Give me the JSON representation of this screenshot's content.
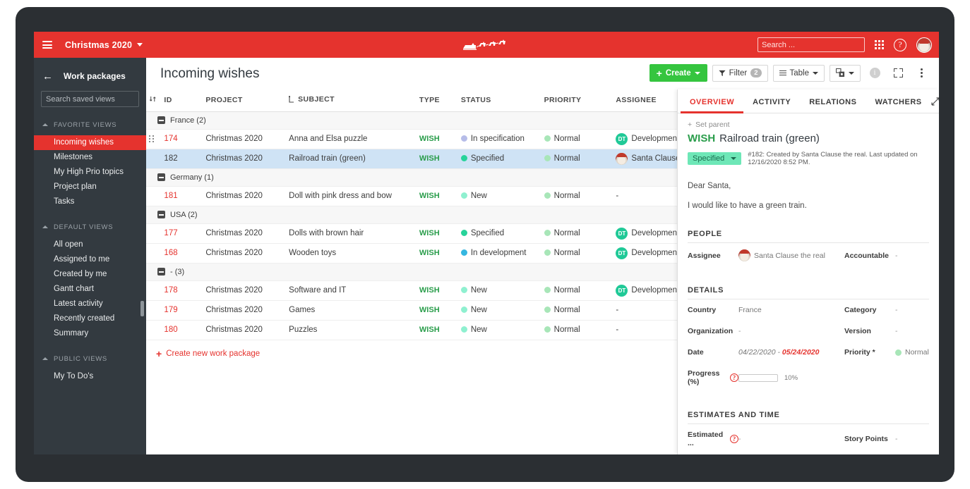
{
  "theme": {
    "brand_red": "#e5332e",
    "sidebar_dark": "#333a40",
    "create_green": "#35c53f",
    "type_green": "#2a9d4b",
    "selected_row_blue": "#cfe3f5"
  },
  "topbar": {
    "menu_icon": "hamburger-icon",
    "project_name": "Christmas 2020",
    "project_caret": "chevron-down-icon",
    "logo": "santa-sleigh-reindeer-logo",
    "search_placeholder": "Search ...",
    "search_value": "",
    "search_icon": "search-icon",
    "apps_icon": "grid-apps-icon",
    "help_icon": "help-circle-icon",
    "help_glyph": "?",
    "avatar": "user-avatar-santa"
  },
  "sidebar": {
    "back_icon": "arrow-left-icon",
    "title": "Work packages",
    "search_placeholder": "Search saved views",
    "search_value": "",
    "search_icon": "search-icon",
    "groups": [
      {
        "label": "FAVORITE VIEWS",
        "items": [
          {
            "label": "Incoming wishes",
            "active": true
          },
          {
            "label": "Milestones",
            "active": false
          },
          {
            "label": "My High Prio topics",
            "active": false
          },
          {
            "label": "Project plan",
            "active": false
          },
          {
            "label": "Tasks",
            "active": false
          }
        ]
      },
      {
        "label": "DEFAULT VIEWS",
        "items": [
          {
            "label": "All open",
            "active": false
          },
          {
            "label": "Assigned to me",
            "active": false
          },
          {
            "label": "Created by me",
            "active": false
          },
          {
            "label": "Gantt chart",
            "active": false
          },
          {
            "label": "Latest activity",
            "active": false
          },
          {
            "label": "Recently created",
            "active": false
          },
          {
            "label": "Summary",
            "active": false
          }
        ]
      },
      {
        "label": "PUBLIC VIEWS",
        "items": [
          {
            "label": "My To Do's",
            "active": false
          }
        ]
      }
    ]
  },
  "main": {
    "page_title": "Incoming wishes",
    "toolbar": {
      "create_label": "Create",
      "filter_label": "Filter",
      "filter_count": "2",
      "table_label": "Table",
      "settings_icon": "view-configuration-icon",
      "info_icon": "info-circle-icon",
      "fullscreen_icon": "fullscreen-icon",
      "more_icon": "kebab-more-icon"
    },
    "columns": [
      {
        "key": "sort",
        "label": "",
        "icon": "sort-icon"
      },
      {
        "key": "id",
        "label": "ID"
      },
      {
        "key": "project",
        "label": "PROJECT"
      },
      {
        "key": "subject",
        "label": "SUBJECT",
        "icon": "hierarchy-icon"
      },
      {
        "key": "type",
        "label": "TYPE"
      },
      {
        "key": "status",
        "label": "STATUS"
      },
      {
        "key": "priority",
        "label": "PRIORITY"
      },
      {
        "key": "assignee",
        "label": "ASSIGNEE"
      }
    ],
    "groups": [
      {
        "label": "France (2)",
        "rows": [
          {
            "id": "174",
            "project": "Christmas 2020",
            "subject": "Anna and Elsa puzzle",
            "type": "WISH",
            "status": "In specification",
            "status_color": "#b6bce8",
            "priority": "Normal",
            "priority_color": "#a8e6b8",
            "assignee": "Development",
            "assignee_initials": "DT",
            "assignee_kind": "team",
            "selected": false,
            "has_handle": true
          },
          {
            "id": "182",
            "project": "Christmas 2020",
            "subject": "Railroad train (green)",
            "type": "WISH",
            "status": "Specified",
            "status_color": "#27d39a",
            "priority": "Normal",
            "priority_color": "#a8e6b8",
            "assignee": "Santa Clause t",
            "assignee_initials": "",
            "assignee_kind": "santa",
            "selected": true,
            "has_handle": false
          }
        ]
      },
      {
        "label": "Germany (1)",
        "rows": [
          {
            "id": "181",
            "project": "Christmas 2020",
            "subject": "Doll with pink dress and bow",
            "type": "WISH",
            "status": "New",
            "status_color": "#8ff0d0",
            "priority": "Normal",
            "priority_color": "#a8e6b8",
            "assignee": "-",
            "assignee_initials": "",
            "assignee_kind": "none",
            "selected": false,
            "has_handle": false
          }
        ]
      },
      {
        "label": "USA (2)",
        "rows": [
          {
            "id": "177",
            "project": "Christmas 2020",
            "subject": "Dolls with brown hair",
            "type": "WISH",
            "status": "Specified",
            "status_color": "#27d39a",
            "priority": "Normal",
            "priority_color": "#a8e6b8",
            "assignee": "Development",
            "assignee_initials": "DT",
            "assignee_kind": "team",
            "selected": false,
            "has_handle": false
          },
          {
            "id": "168",
            "project": "Christmas 2020",
            "subject": "Wooden toys",
            "type": "WISH",
            "status": "In development",
            "status_color": "#35b7e0",
            "priority": "Normal",
            "priority_color": "#a8e6b8",
            "assignee": "Development",
            "assignee_initials": "DT",
            "assignee_kind": "team",
            "selected": false,
            "has_handle": false
          }
        ]
      },
      {
        "label": "- (3)",
        "rows": [
          {
            "id": "178",
            "project": "Christmas 2020",
            "subject": "Software and IT",
            "type": "WISH",
            "status": "New",
            "status_color": "#8ff0d0",
            "priority": "Normal",
            "priority_color": "#a8e6b8",
            "assignee": "Development",
            "assignee_initials": "DT",
            "assignee_kind": "team",
            "selected": false,
            "has_handle": false
          },
          {
            "id": "179",
            "project": "Christmas 2020",
            "subject": "Games",
            "type": "WISH",
            "status": "New",
            "status_color": "#8ff0d0",
            "priority": "Normal",
            "priority_color": "#a8e6b8",
            "assignee": "-",
            "assignee_initials": "",
            "assignee_kind": "none",
            "selected": false,
            "has_handle": false
          },
          {
            "id": "180",
            "project": "Christmas 2020",
            "subject": "Puzzles",
            "type": "WISH",
            "status": "New",
            "status_color": "#8ff0d0",
            "priority": "Normal",
            "priority_color": "#a8e6b8",
            "assignee": "-",
            "assignee_initials": "",
            "assignee_kind": "none",
            "selected": false,
            "has_handle": false
          }
        ]
      }
    ],
    "create_new_label": "Create new work package"
  },
  "detail_panel": {
    "tabs": [
      {
        "label": "OVERVIEW",
        "active": true
      },
      {
        "label": "ACTIVITY",
        "active": false
      },
      {
        "label": "RELATIONS",
        "active": false
      },
      {
        "label": "WATCHERS",
        "active": false
      }
    ],
    "expand_icon": "expand-diagonal-icon",
    "close_icon": "close-icon",
    "set_parent_label": "Set parent",
    "type_label": "WISH",
    "title": "Railroad train (green)",
    "status": "Specified",
    "status_caret": "chevron-down-icon",
    "meta": "#182: Created by Santa Clause the real. Last updated on 12/16/2020 8:52 PM.",
    "description_lines": [
      "Dear Santa,",
      "I would like to have a green train."
    ],
    "people_section": "PEOPLE",
    "people": {
      "assignee_label": "Assignee",
      "assignee_value": "Santa Clause the real",
      "accountable_label": "Accountable",
      "accountable_value": "-"
    },
    "details_section": "DETAILS",
    "details": {
      "country_label": "Country",
      "country_value": "France",
      "category_label": "Category",
      "category_value": "-",
      "organization_label": "Organization",
      "organization_value": "-",
      "version_label": "Version",
      "version_value": "-",
      "date_label": "Date",
      "date_from": "04/22/2020",
      "date_sep": " - ",
      "date_to": "05/24/2020",
      "priority_label": "Priority *",
      "priority_value": "Normal",
      "priority_color": "#a8e6b8",
      "progress_label": "Progress (%)",
      "progress_percent": 10,
      "progress_value": "10%"
    },
    "estimates_section": "ESTIMATES AND TIME",
    "estimates": {
      "estimated_label": "Estimated ...",
      "estimated_value": "-",
      "story_points_label": "Story Points",
      "story_points_value": "-"
    }
  }
}
